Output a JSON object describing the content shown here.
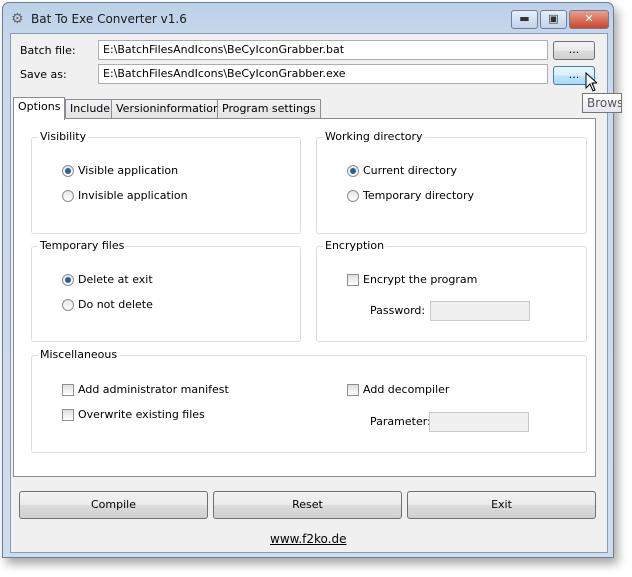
{
  "window": {
    "title": "Bat To Exe Converter v1.6",
    "minimize": "▬",
    "maximize": "▣",
    "close": "✕"
  },
  "files": {
    "batch_label": "Batch file:",
    "batch_value": "E:\\BatchFilesAndIcons\\BeCyIconGrabber.bat",
    "save_label": "Save as:",
    "save_value": "E:\\BatchFilesAndIcons\\BeCyIconGrabber.exe",
    "browse": "...",
    "tooltip": "Browse"
  },
  "tabs": [
    "Options",
    "Include",
    "Versioninformations",
    "Program settings"
  ],
  "visibility": {
    "title": "Visibility",
    "opt1": "Visible application",
    "opt2": "Invisible application"
  },
  "workdir": {
    "title": "Working directory",
    "opt1": "Current directory",
    "opt2": "Temporary directory"
  },
  "temp": {
    "title": "Temporary files",
    "opt1": "Delete at exit",
    "opt2": "Do not delete"
  },
  "encryption": {
    "title": "Encryption",
    "check": "Encrypt the program",
    "password": "Password:"
  },
  "misc": {
    "title": "Miscellaneous",
    "admin": "Add administrator manifest",
    "overwrite": "Overwrite existing files",
    "decompiler": "Add decompiler",
    "parameter": "Parameter:"
  },
  "buttons": {
    "compile": "Compile",
    "reset": "Reset",
    "exit": "Exit"
  },
  "link": "www.f2ko.de"
}
